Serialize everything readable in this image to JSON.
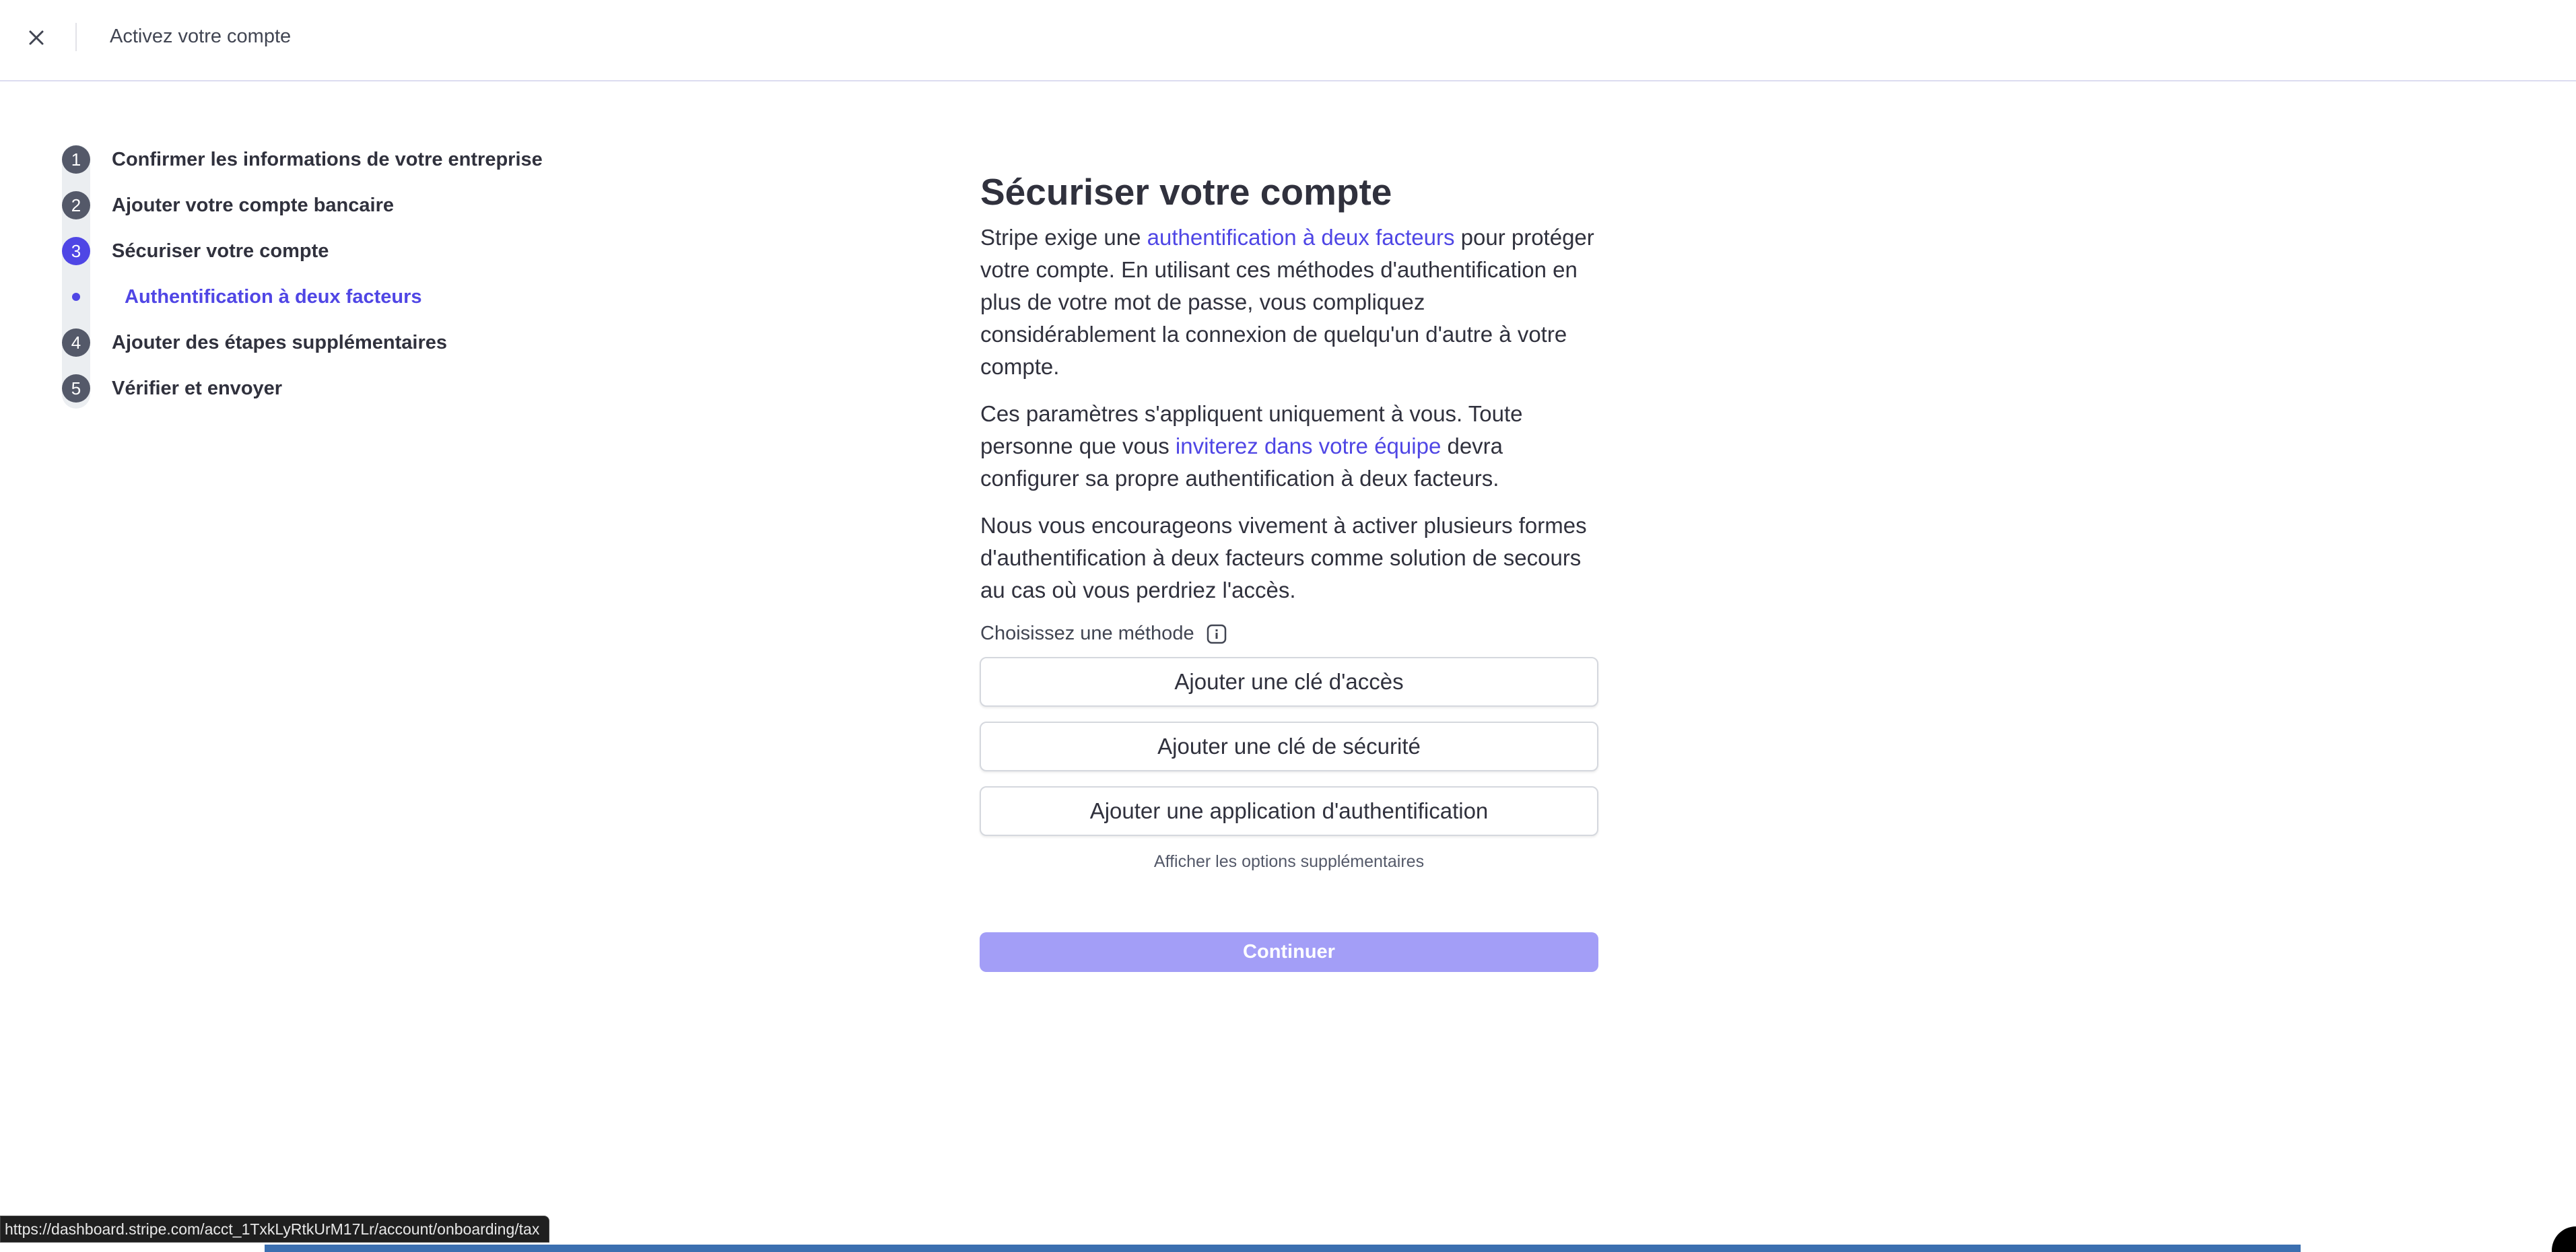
{
  "header": {
    "title": "Activez votre compte"
  },
  "stepper": {
    "steps": [
      {
        "number": "1",
        "label": "Confirmer les informations de votre entreprise"
      },
      {
        "number": "2",
        "label": "Ajouter votre compte bancaire"
      },
      {
        "number": "3",
        "label": "Sécuriser votre compte"
      },
      {
        "number": "4",
        "label": "Ajouter des étapes supplémentaires"
      },
      {
        "number": "5",
        "label": "Vérifier et envoyer"
      }
    ],
    "active_step": "3",
    "substep_label": "Authentification à deux facteurs"
  },
  "main": {
    "title": "Sécuriser votre compte",
    "para1": {
      "before": "Stripe exige une ",
      "link": "authentification à deux facteurs",
      "after": " pour protéger votre compte. En utilisant ces méthodes d'authentification en plus de votre mot de passe, vous compliquez considérablement la connexion de quelqu'un d'autre à votre compte."
    },
    "para2": {
      "before": "Ces paramètres s'appliquent uniquement à vous. Toute personne que vous ",
      "link": "inviterez dans votre équipe",
      "after": " devra configurer sa propre authentification à deux facteurs."
    },
    "para3": "Nous vous encourageons vivement à activer plusieurs formes d'authentification à deux facteurs comme solution de secours au cas où vous perdriez l'accès.",
    "method_label": "Choisissez une méthode",
    "buttons": {
      "passkey": "Ajouter une clé d'accès",
      "security_key": "Ajouter une clé de sécurité",
      "auth_app": "Ajouter une application d'authentification"
    },
    "more_options": "Afficher les options supplémentaires",
    "continue": "Continuer"
  },
  "status_bar": {
    "url": "https://dashboard.stripe.com/acct_1TxkLyRtkUrM17Lr/account/onboarding/tax"
  },
  "colors": {
    "accent": "#4f46e5",
    "continue_disabled": "#a39ef7",
    "step_inactive": "#545969"
  },
  "icons": {
    "close": "close-icon",
    "info": "info-icon"
  }
}
